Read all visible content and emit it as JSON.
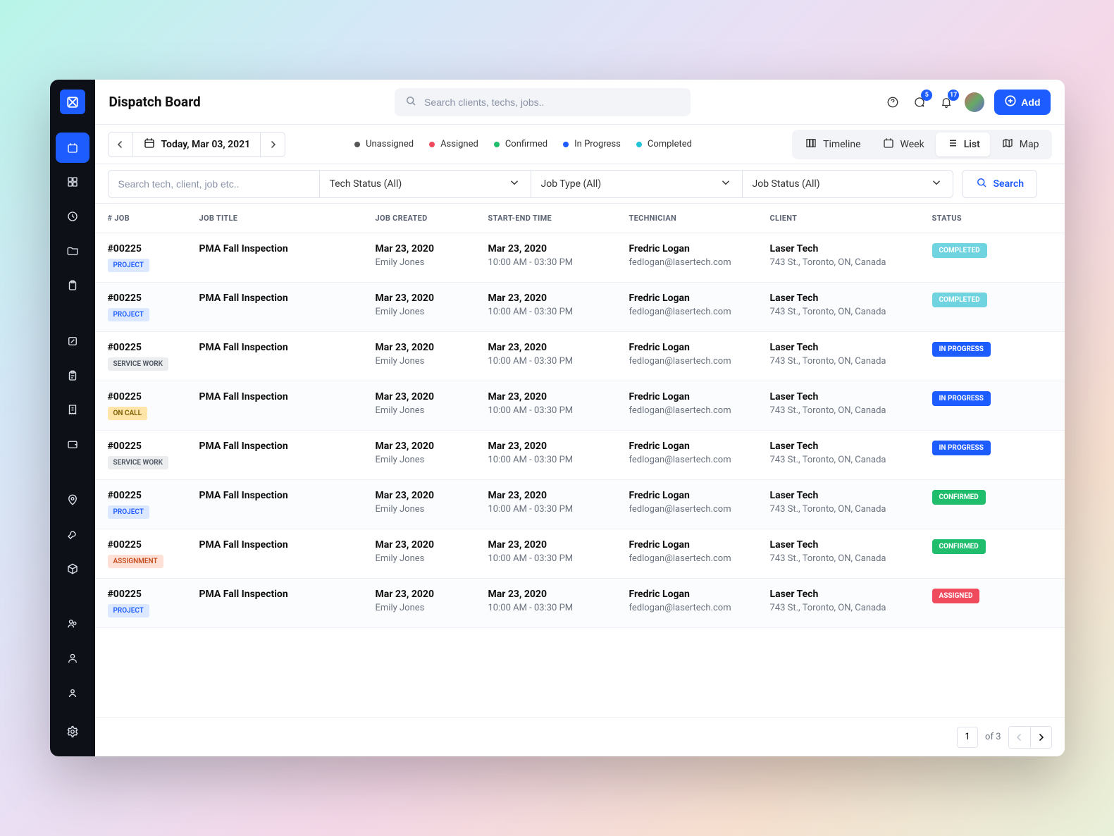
{
  "header": {
    "title": "Dispatch Board",
    "search_placeholder": "Search clients, techs, jobs..",
    "add_label": "Add",
    "chat_badge": "5",
    "bell_badge": "17"
  },
  "toolbar": {
    "date_label": "Today, Mar 03, 2021",
    "legend": [
      {
        "label": "Unassigned",
        "color": "#555"
      },
      {
        "label": "Assigned",
        "color": "#ef4b5c"
      },
      {
        "label": "Confirmed",
        "color": "#1fbd6c"
      },
      {
        "label": "In Progress",
        "color": "#1d5cff"
      },
      {
        "label": "Completed",
        "color": "#24c4d8"
      }
    ],
    "views": {
      "timeline": "Timeline",
      "week": "Week",
      "list": "List",
      "map": "Map",
      "active": "list"
    }
  },
  "filters": {
    "search_placeholder": "Search tech, client, job etc..",
    "tech_status": "Tech Status (All)",
    "job_type": "Job Type (All)",
    "job_status": "Job Status (All)",
    "search_label": "Search"
  },
  "columns": [
    "# JOB",
    "JOB TITLE",
    "JOB CREATED",
    "START-END TIME",
    "TECHNICIAN",
    "CLIENT",
    "STATUS"
  ],
  "rows": [
    {
      "id": "#00225",
      "type": "PROJECT",
      "type_class": "pill-project",
      "title": "PMA Fall Inspection",
      "created_date": "Mar 23, 2020",
      "created_by": "Emily Jones",
      "start_date": "Mar 23, 2020",
      "start_time": "10:00 AM - 03:30 PM",
      "tech": "Fredric Logan",
      "tech_email": "fedlogan@lasertech.com",
      "client": "Laser Tech",
      "client_addr": "743 St., Toronto, ON, Canada",
      "status": "COMPLETED",
      "status_class": "st-completed"
    },
    {
      "id": "#00225",
      "type": "PROJECT",
      "type_class": "pill-project",
      "title": "PMA Fall Inspection",
      "created_date": "Mar 23, 2020",
      "created_by": "Emily Jones",
      "start_date": "Mar 23, 2020",
      "start_time": "10:00 AM - 03:30 PM",
      "tech": "Fredric Logan",
      "tech_email": "fedlogan@lasertech.com",
      "client": "Laser Tech",
      "client_addr": "743 St., Toronto, ON, Canada",
      "status": "COMPLETED",
      "status_class": "st-completed"
    },
    {
      "id": "#00225",
      "type": "SERVICE WORK",
      "type_class": "pill-service",
      "title": "PMA Fall Inspection",
      "created_date": "Mar 23, 2020",
      "created_by": "Emily Jones",
      "start_date": "Mar 23, 2020",
      "start_time": "10:00 AM - 03:30 PM",
      "tech": "Fredric Logan",
      "tech_email": "fedlogan@lasertech.com",
      "client": "Laser Tech",
      "client_addr": "743 St., Toronto, ON, Canada",
      "status": "IN PROGRESS",
      "status_class": "st-inprogress"
    },
    {
      "id": "#00225",
      "type": "ON CALL",
      "type_class": "pill-oncall",
      "title": "PMA Fall Inspection",
      "created_date": "Mar 23, 2020",
      "created_by": "Emily Jones",
      "start_date": "Mar 23, 2020",
      "start_time": "10:00 AM - 03:30 PM",
      "tech": "Fredric Logan",
      "tech_email": "fedlogan@lasertech.com",
      "client": "Laser Tech",
      "client_addr": "743 St., Toronto, ON, Canada",
      "status": "IN PROGRESS",
      "status_class": "st-inprogress"
    },
    {
      "id": "#00225",
      "type": "SERVICE WORK",
      "type_class": "pill-service",
      "title": "PMA Fall Inspection",
      "created_date": "Mar 23, 2020",
      "created_by": "Emily Jones",
      "start_date": "Mar 23, 2020",
      "start_time": "10:00 AM - 03:30 PM",
      "tech": "Fredric Logan",
      "tech_email": "fedlogan@lasertech.com",
      "client": "Laser Tech",
      "client_addr": "743 St., Toronto, ON, Canada",
      "status": "IN PROGRESS",
      "status_class": "st-inprogress"
    },
    {
      "id": "#00225",
      "type": "PROJECT",
      "type_class": "pill-project",
      "title": "PMA Fall Inspection",
      "created_date": "Mar 23, 2020",
      "created_by": "Emily Jones",
      "start_date": "Mar 23, 2020",
      "start_time": "10:00 AM - 03:30 PM",
      "tech": "Fredric Logan",
      "tech_email": "fedlogan@lasertech.com",
      "client": "Laser Tech",
      "client_addr": "743 St., Toronto, ON, Canada",
      "status": "CONFIRMED",
      "status_class": "st-confirmed"
    },
    {
      "id": "#00225",
      "type": "ASSIGNMENT",
      "type_class": "pill-assign",
      "title": "PMA Fall Inspection",
      "created_date": "Mar 23, 2020",
      "created_by": "Emily Jones",
      "start_date": "Mar 23, 2020",
      "start_time": "10:00 AM - 03:30 PM",
      "tech": "Fredric Logan",
      "tech_email": "fedlogan@lasertech.com",
      "client": "Laser Tech",
      "client_addr": "743 St., Toronto, ON, Canada",
      "status": "CONFIRMED",
      "status_class": "st-confirmed"
    },
    {
      "id": "#00225",
      "type": "PROJECT",
      "type_class": "pill-project",
      "title": "PMA Fall Inspection",
      "created_date": "Mar 23, 2020",
      "created_by": "Emily Jones",
      "start_date": "Mar 23, 2020",
      "start_time": "10:00 AM - 03:30 PM",
      "tech": "Fredric Logan",
      "tech_email": "fedlogan@lasertech.com",
      "client": "Laser Tech",
      "client_addr": "743 St., Toronto, ON, Canada",
      "status": "ASSIGNED",
      "status_class": "st-assigned"
    }
  ],
  "pager": {
    "current": "1",
    "of_label": "of 3"
  }
}
